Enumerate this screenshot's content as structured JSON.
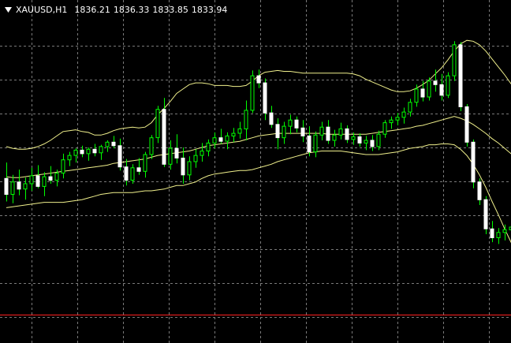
{
  "colors": {
    "background": "#000000",
    "grid": "#7a7a7a",
    "bull": "#00ff00",
    "bear_body": "#ffffff",
    "bear_wick": "#00ff00",
    "bands": "#f0f08c",
    "hline": "#ff2020",
    "header_text": "#ffffff"
  },
  "header": {
    "menu_icon": "triangle-down-icon",
    "symbol_tf": "XAUUSD,H1",
    "open": "1836.21",
    "high": "1836.33",
    "low": "1833.85",
    "close": "1833.94"
  },
  "chart_data": {
    "type": "candlestick",
    "symbol": "XAUUSD",
    "timeframe": "H1",
    "ohlc": [
      [
        1836.0,
        1837.8,
        1833.4,
        1834.2
      ],
      [
        1834.2,
        1836.4,
        1833.2,
        1835.6
      ],
      [
        1835.6,
        1837.0,
        1834.1,
        1834.8
      ],
      [
        1834.8,
        1836.1,
        1833.6,
        1835.4
      ],
      [
        1835.4,
        1837.2,
        1834.6,
        1836.3
      ],
      [
        1836.3,
        1837.5,
        1834.9,
        1835.1
      ],
      [
        1835.1,
        1836.7,
        1834.0,
        1836.2
      ],
      [
        1836.2,
        1837.4,
        1835.4,
        1835.8
      ],
      [
        1835.8,
        1837.0,
        1835.1,
        1836.6
      ],
      [
        1836.6,
        1838.8,
        1836.0,
        1838.1
      ],
      [
        1838.1,
        1839.0,
        1837.4,
        1838.6
      ],
      [
        1838.6,
        1839.4,
        1837.8,
        1839.2
      ],
      [
        1839.2,
        1839.7,
        1838.4,
        1838.8
      ],
      [
        1838.8,
        1839.5,
        1838.0,
        1839.3
      ],
      [
        1839.3,
        1839.9,
        1838.5,
        1838.9
      ],
      [
        1838.9,
        1839.8,
        1838.1,
        1839.6
      ],
      [
        1839.6,
        1840.3,
        1839.0,
        1840.1
      ],
      [
        1840.1,
        1840.8,
        1839.4,
        1839.7
      ],
      [
        1839.7,
        1840.5,
        1836.9,
        1837.3
      ],
      [
        1837.3,
        1838.2,
        1835.2,
        1835.8
      ],
      [
        1835.8,
        1837.6,
        1835.4,
        1837.2
      ],
      [
        1837.2,
        1838.3,
        1836.4,
        1836.8
      ],
      [
        1836.8,
        1839.0,
        1836.1,
        1838.7
      ],
      [
        1838.7,
        1840.9,
        1838.2,
        1840.6
      ],
      [
        1840.6,
        1844.2,
        1840.0,
        1843.8
      ],
      [
        1843.8,
        1845.1,
        1837.3,
        1837.6
      ],
      [
        1837.6,
        1840.3,
        1837.0,
        1839.4
      ],
      [
        1839.4,
        1841.0,
        1837.7,
        1838.3
      ],
      [
        1838.3,
        1839.5,
        1835.4,
        1836.4
      ],
      [
        1836.4,
        1838.5,
        1835.8,
        1837.9
      ],
      [
        1837.9,
        1839.3,
        1837.2,
        1838.6
      ],
      [
        1838.6,
        1840.0,
        1837.9,
        1839.1
      ],
      [
        1839.1,
        1840.4,
        1838.5,
        1840.0
      ],
      [
        1840.0,
        1841.2,
        1839.4,
        1840.6
      ],
      [
        1840.6,
        1841.6,
        1839.9,
        1840.2
      ],
      [
        1840.2,
        1841.2,
        1839.3,
        1840.8
      ],
      [
        1840.8,
        1841.7,
        1840.1,
        1841.1
      ],
      [
        1841.1,
        1842.4,
        1840.5,
        1841.6
      ],
      [
        1841.6,
        1844.8,
        1840.3,
        1843.7
      ],
      [
        1843.7,
        1848.2,
        1843.4,
        1847.6
      ],
      [
        1847.6,
        1848.3,
        1846.2,
        1846.8
      ],
      [
        1846.8,
        1847.3,
        1842.6,
        1843.4
      ],
      [
        1843.4,
        1844.2,
        1841.7,
        1842.1
      ],
      [
        1842.1,
        1842.8,
        1839.3,
        1840.6
      ],
      [
        1840.6,
        1842.4,
        1839.9,
        1841.9
      ],
      [
        1841.9,
        1843.2,
        1841.0,
        1842.6
      ],
      [
        1842.6,
        1843.0,
        1841.2,
        1841.7
      ],
      [
        1841.7,
        1842.6,
        1840.1,
        1840.8
      ],
      [
        1840.8,
        1841.9,
        1838.5,
        1839.0
      ],
      [
        1839.0,
        1841.3,
        1838.4,
        1840.9
      ],
      [
        1840.9,
        1842.4,
        1840.3,
        1841.8
      ],
      [
        1841.8,
        1842.6,
        1839.9,
        1840.3
      ],
      [
        1840.3,
        1841.5,
        1839.6,
        1840.9
      ],
      [
        1840.9,
        1842.3,
        1840.4,
        1841.6
      ],
      [
        1841.6,
        1842.0,
        1840.0,
        1840.4
      ],
      [
        1840.4,
        1841.2,
        1839.8,
        1840.7
      ],
      [
        1840.7,
        1841.1,
        1839.6,
        1840.0
      ],
      [
        1840.0,
        1840.8,
        1839.2,
        1840.3
      ],
      [
        1840.3,
        1840.9,
        1839.1,
        1839.6
      ],
      [
        1839.6,
        1841.4,
        1839.2,
        1841.0
      ],
      [
        1841.0,
        1842.6,
        1840.6,
        1842.3
      ],
      [
        1842.3,
        1843.0,
        1841.6,
        1842.6
      ],
      [
        1842.6,
        1843.4,
        1842.0,
        1842.9
      ],
      [
        1842.9,
        1844.0,
        1842.2,
        1843.5
      ],
      [
        1843.5,
        1845.0,
        1843.0,
        1844.6
      ],
      [
        1844.6,
        1846.6,
        1844.1,
        1846.1
      ],
      [
        1846.1,
        1847.0,
        1844.7,
        1845.2
      ],
      [
        1845.2,
        1847.4,
        1844.8,
        1847.0
      ],
      [
        1847.0,
        1848.3,
        1845.8,
        1846.6
      ],
      [
        1846.6,
        1847.8,
        1844.8,
        1845.4
      ],
      [
        1845.4,
        1848.0,
        1845.1,
        1847.6
      ],
      [
        1847.6,
        1851.5,
        1847.0,
        1851.1
      ],
      [
        1851.1,
        1851.4,
        1843.6,
        1844.1
      ],
      [
        1844.1,
        1844.4,
        1839.6,
        1840.1
      ],
      [
        1840.1,
        1840.4,
        1834.9,
        1835.6
      ],
      [
        1835.6,
        1836.0,
        1833.0,
        1833.6
      ],
      [
        1833.6,
        1834.0,
        1829.7,
        1830.3
      ],
      [
        1830.3,
        1831.2,
        1828.8,
        1829.3
      ],
      [
        1829.3,
        1830.4,
        1828.6,
        1829.9
      ],
      [
        1829.9,
        1830.8,
        1829.0,
        1830.2
      ],
      [
        1830.2,
        1831.1,
        1829.2,
        1830.5
      ],
      [
        1830.5,
        1830.9,
        1828.7,
        1829.4
      ]
    ],
    "bollinger": {
      "upper": [
        1839.6,
        1839.4,
        1839.3,
        1839.3,
        1839.4,
        1839.6,
        1839.9,
        1840.3,
        1840.8,
        1841.3,
        1841.4,
        1841.5,
        1841.3,
        1841.2,
        1840.9,
        1840.9,
        1841.1,
        1841.4,
        1841.6,
        1841.7,
        1841.8,
        1841.7,
        1841.8,
        1842.3,
        1843.2,
        1843.9,
        1844.7,
        1845.6,
        1846.1,
        1846.6,
        1846.8,
        1846.8,
        1846.7,
        1846.5,
        1846.5,
        1846.5,
        1846.4,
        1846.4,
        1846.5,
        1847.0,
        1847.6,
        1848.0,
        1848.1,
        1848.2,
        1848.1,
        1848.1,
        1848.0,
        1847.9,
        1847.9,
        1847.9,
        1847.9,
        1847.9,
        1847.9,
        1847.9,
        1847.9,
        1847.8,
        1847.6,
        1847.2,
        1846.9,
        1846.6,
        1846.3,
        1846.0,
        1845.8,
        1845.8,
        1845.9,
        1846.2,
        1846.6,
        1847.1,
        1847.8,
        1848.5,
        1849.4,
        1850.4,
        1851.2,
        1851.6,
        1851.5,
        1851.1,
        1850.4,
        1849.5,
        1848.6,
        1847.7,
        1846.7,
        1845.8,
        1845.0
      ],
      "middle": [
        1836.2,
        1836.1,
        1836.1,
        1836.2,
        1836.3,
        1836.4,
        1836.5,
        1836.6,
        1836.7,
        1836.8,
        1836.9,
        1837.0,
        1837.1,
        1837.2,
        1837.3,
        1837.4,
        1837.5,
        1837.7,
        1837.8,
        1837.9,
        1838.0,
        1838.1,
        1838.2,
        1838.4,
        1838.6,
        1838.7,
        1838.8,
        1838.9,
        1839.0,
        1839.1,
        1839.3,
        1839.5,
        1839.7,
        1839.8,
        1839.9,
        1840.0,
        1840.1,
        1840.2,
        1840.4,
        1840.6,
        1840.8,
        1840.9,
        1841.0,
        1841.1,
        1841.1,
        1841.1,
        1841.1,
        1841.1,
        1841.1,
        1841.1,
        1841.1,
        1841.0,
        1841.0,
        1841.0,
        1841.0,
        1841.0,
        1841.0,
        1841.0,
        1841.1,
        1841.2,
        1841.3,
        1841.4,
        1841.5,
        1841.6,
        1841.7,
        1841.9,
        1842.0,
        1842.2,
        1842.4,
        1842.6,
        1842.8,
        1843.0,
        1842.8,
        1842.5,
        1842.1,
        1841.6,
        1841.1,
        1840.5,
        1840.0,
        1839.4,
        1838.8,
        1838.3,
        1837.8
      ],
      "lower": [
        1832.7,
        1832.8,
        1832.9,
        1833.0,
        1833.1,
        1833.2,
        1833.3,
        1833.3,
        1833.3,
        1833.3,
        1833.4,
        1833.5,
        1833.6,
        1833.8,
        1834.0,
        1834.2,
        1834.3,
        1834.4,
        1834.4,
        1834.4,
        1834.4,
        1834.5,
        1834.6,
        1834.6,
        1834.7,
        1834.8,
        1835.0,
        1835.2,
        1835.2,
        1835.4,
        1835.6,
        1836.0,
        1836.3,
        1836.5,
        1836.6,
        1836.7,
        1836.8,
        1836.9,
        1836.9,
        1837.0,
        1837.2,
        1837.4,
        1837.6,
        1837.9,
        1838.1,
        1838.3,
        1838.5,
        1838.7,
        1838.9,
        1839.0,
        1839.1,
        1839.1,
        1839.1,
        1839.1,
        1839.0,
        1838.9,
        1838.8,
        1838.7,
        1838.7,
        1838.7,
        1838.8,
        1838.9,
        1839.0,
        1839.2,
        1839.4,
        1839.5,
        1839.6,
        1839.8,
        1839.8,
        1839.9,
        1839.9,
        1839.8,
        1839.3,
        1838.6,
        1837.6,
        1836.4,
        1835.0,
        1833.4,
        1831.9,
        1830.3,
        1828.8,
        1827.3,
        1825.8
      ]
    },
    "hline": 1820.6,
    "ylim": [
      1818.3,
      1854.2
    ],
    "grid": true,
    "xlabel": "",
    "ylabel": ""
  }
}
